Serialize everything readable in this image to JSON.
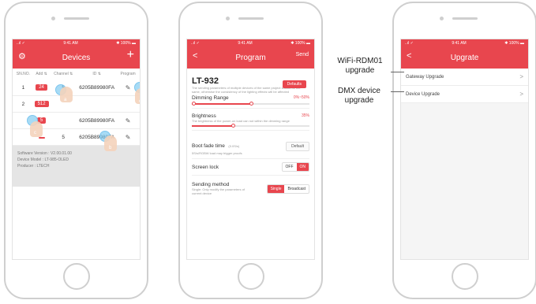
{
  "status": {
    "signal": "..ıl ✓",
    "time": "9:41 AM",
    "battery": "✱ 100% ▬"
  },
  "devices": {
    "title": "Devices",
    "plus": "+",
    "settings_icon": "⚙",
    "columns": [
      "SN.NO.",
      "Add ⇅",
      "Channel ⇅",
      "ID ⇅",
      "Program"
    ],
    "rows": [
      {
        "sn": "1",
        "addr": "24",
        "ch": "5",
        "id": "6205B89980FA",
        "prog": "✎"
      },
      {
        "sn": "2",
        "addr": "512",
        "ch": "",
        "id": "",
        "prog": ""
      },
      {
        "sn": "",
        "addr": "5",
        "ch": "",
        "id": "6205B89980FA",
        "prog": "✎"
      },
      {
        "sn": "",
        "addr": "",
        "ch": "5",
        "id": "6205B89980FA",
        "prog": "✎"
      }
    ],
    "annotations": [
      "a",
      "b",
      "c",
      "d",
      "e"
    ],
    "info": [
      "Software Version : V2.00.01.00",
      "Device Model : LT-985-OLED",
      "Producer : LTECH"
    ]
  },
  "program": {
    "back": "<",
    "title": "Program",
    "send": "Send",
    "model": "LT-932",
    "defaults": "Defaults",
    "desc": "The sending parameters of multiple devices of the same project should be the same, otherwise the consistency of the lighting effects will be affected",
    "dimming_label": "Dimming Range",
    "dimming_value": "0%~50%",
    "dimming_level": 0.5,
    "brightness_label": "Brightness",
    "brightness_value": "35%",
    "brightness_level": 0.35,
    "brightness_desc": "The brightness of the power-on load can not within the dimming range",
    "boot_label": "Boot fade time",
    "boot_sub": "(0.0S/s)",
    "boot_desc": "5S/s/RGBW load may trigger proofs",
    "boot_button": "Default",
    "screen_lock_label": "Screen lock",
    "off": "OFF",
    "on": "ON",
    "sending_label": "Sending method",
    "sending_desc": "Single: Only modify the parameters of current device",
    "single": "Single",
    "broadcast": "Broadcast"
  },
  "upgrade": {
    "back": "<",
    "title": "Upgrate",
    "items": [
      "Gateway Upgrade",
      "Device Upgrade"
    ],
    "chevron": ">"
  },
  "callouts": {
    "wifi": [
      "WiFi-RDM01",
      "upgrade"
    ],
    "dmx": [
      "DMX device",
      "upgrade"
    ]
  }
}
